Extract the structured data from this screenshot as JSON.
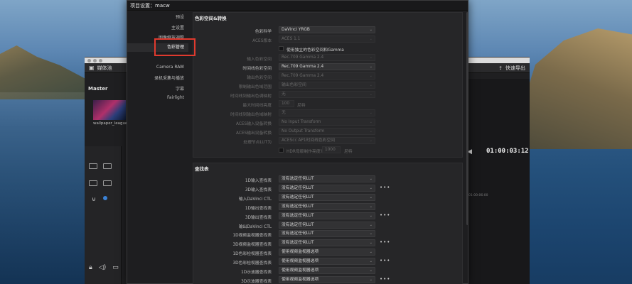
{
  "window": {
    "media_pool_label": "媒体池",
    "quick_export_label": "快速导出",
    "master_label": "Master",
    "clip_name": "wallpaper_league_",
    "timecode": "01:00:03:12",
    "ruler_tick": "01:00:06:00"
  },
  "dialog": {
    "title": "项目设置：macw",
    "nav": [
      {
        "label": "预设",
        "active": false
      },
      {
        "label": "主设置",
        "active": false
      },
      {
        "label": "图像缩放调整",
        "active": false
      },
      {
        "label": "色彩管理",
        "active": true
      },
      {
        "label": "Camera RAW",
        "active": false
      },
      {
        "label": "录机采集与播放",
        "active": false
      },
      {
        "label": "字幕",
        "active": false
      },
      {
        "label": "Fairlight",
        "active": false
      }
    ],
    "color_space_section": {
      "title": "色彩空间&转换",
      "color_science_label": "色彩科学",
      "color_science_value": "DaVinci YRGB",
      "aces_version_label": "ACES版本",
      "aces_version_value": "ACES 1.1",
      "separate_gamma_label": "使用独立的色彩空间和Gamma",
      "input_color_space_label": "输入色彩空间",
      "input_color_space_value": "Rec.709 Gamma 2.4",
      "timeline_color_space_label": "时间线色彩空间",
      "timeline_color_space_value": "Rec.709 Gamma 2.4",
      "output_color_space_label": "输出色彩空间",
      "output_color_space_value": "Rec.709 Gamma 2.4",
      "limit_output_gamut_label": "限制输出色域范围",
      "limit_output_gamut_value": "输出色彩空间",
      "timeline_tone_mapping_label": "时间线到输出色调映射",
      "timeline_tone_mapping_value": "无",
      "max_timeline_luminance_label": "最大时间线亮度",
      "max_timeline_luminance_value": "100",
      "nits_unit": "尼特",
      "timeline_gamut_mapping_label": "时间线到输出色域映射",
      "timeline_gamut_mapping_value": "无",
      "aces_input_transform_label": "ACES输入设备转换",
      "aces_input_transform_value": "No Input Transform",
      "aces_output_transform_label": "ACES输出设备转换",
      "aces_output_transform_value": "No Output Transform",
      "process_lut_label": "处理节点LUT为",
      "process_lut_value": "ACEScc AP1时间线色彩空间",
      "hdr_mastering_label": "HDR母版制作亮度为",
      "hdr_mastering_value": "1000",
      "hdr_unit": "尼特"
    },
    "lut_section": {
      "title": "查找表",
      "rows": [
        {
          "label": "1D输入查找表",
          "value": "没有选定任何LUT",
          "more": false
        },
        {
          "label": "3D输入查找表",
          "value": "没有选定任何LUT",
          "more": true
        },
        {
          "label": "输入DaVinci CTL",
          "value": "没有选定任何LUT",
          "more": false
        },
        {
          "label": "1D输出查找表",
          "value": "没有选定任何LUT",
          "more": false
        },
        {
          "label": "3D输出查找表",
          "value": "没有选定任何LUT",
          "more": true
        },
        {
          "label": "输出DaVinci CTL",
          "value": "没有选定任何LUT",
          "more": false
        },
        {
          "label": "1D视频监视器查找表",
          "value": "没有选定任何LUT",
          "more": false
        },
        {
          "label": "3D视频监视器查找表",
          "value": "没有选定任何LUT",
          "more": true
        },
        {
          "label": "1D色彩检视器查找表",
          "value": "使用视频监视器选项",
          "more": false
        },
        {
          "label": "3D色彩检视器查找表",
          "value": "使用视频监视器选项",
          "more": true
        },
        {
          "label": "1D示波器查找表",
          "value": "使用视频监视器选项",
          "more": false
        },
        {
          "label": "3D示波器查找表",
          "value": "使用视频监视器选项",
          "more": true
        }
      ],
      "more_glyph": "•••"
    }
  },
  "colors": {
    "highlight_border": "#e03a2e",
    "dialog_bg": "#1e1e20",
    "panel_bg": "#262628"
  }
}
